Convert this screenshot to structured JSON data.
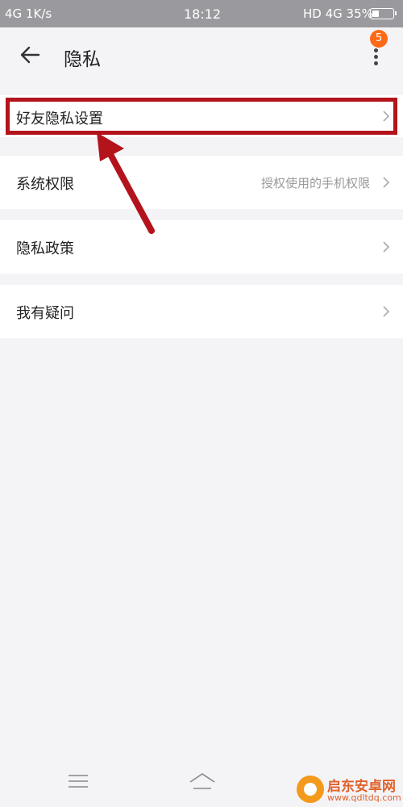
{
  "status_bar": {
    "left": "4G 1K/s",
    "time": "18:12",
    "right": "HD 4G 35%",
    "battery_level": 0.35
  },
  "header": {
    "title": "隐私",
    "badge_count": "5"
  },
  "rows": [
    {
      "label": "好友隐私设置",
      "hint": ""
    },
    {
      "label": "系统权限",
      "hint": "授权使用的手机权限"
    },
    {
      "label": "隐私政策",
      "hint": ""
    },
    {
      "label": "我有疑问",
      "hint": ""
    }
  ],
  "watermark": {
    "title": "启东安卓网",
    "url": "www.qdltdq.com"
  },
  "colors": {
    "highlight_box": "#b3141c",
    "badge": "#ff6a16",
    "status_bar": "#9a9a9e"
  },
  "icons": [
    "back-arrow-icon",
    "more-vertical-icon",
    "chevron-right-icon",
    "menu-icon",
    "home-icon"
  ]
}
